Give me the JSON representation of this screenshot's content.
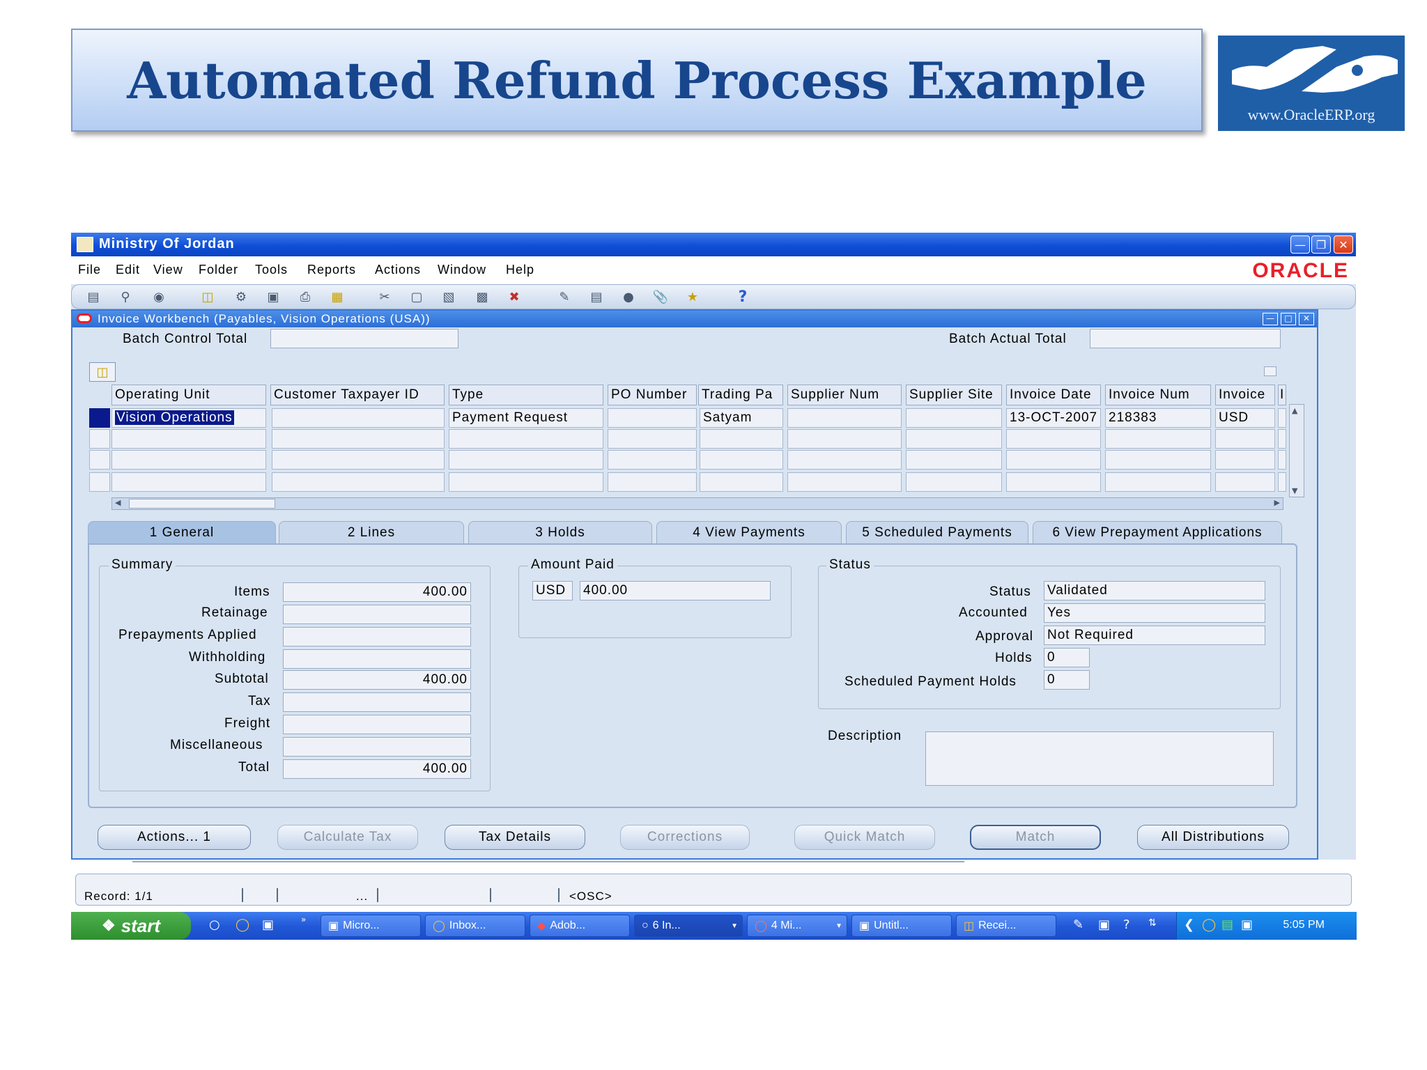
{
  "slide": {
    "title": "Automated Refund Process Example",
    "logo_url": "www.OracleERP.org"
  },
  "window": {
    "title": "Ministry Of Jordan",
    "minimize_icon": "minimize-icon",
    "restore_icon": "restore-icon",
    "close_icon": "close-icon"
  },
  "menu": {
    "items": [
      "File",
      "Edit",
      "View",
      "Folder",
      "Tools",
      "Reports",
      "Actions",
      "Window",
      "Help"
    ],
    "brand": "ORACLE"
  },
  "toolbar": {
    "help_glyph": "?"
  },
  "form": {
    "title": "Invoice Workbench (Payables, Vision Operations (USA))",
    "batch_control_total_label": "Batch Control Total",
    "batch_control_total_value": "",
    "batch_actual_total_label": "Batch Actual Total",
    "batch_actual_total_value": "",
    "columns": [
      "Operating Unit",
      "Customer Taxpayer ID",
      "Type",
      "PO Number",
      "Trading Pa",
      "Supplier Num",
      "Supplier Site",
      "Invoice Date",
      "Invoice Num",
      "Invoice",
      "I"
    ],
    "rows": [
      [
        "Vision Operations",
        "",
        "Payment Request",
        "",
        "Satyam",
        "",
        "",
        "13-OCT-2007",
        "218383",
        "USD"
      ],
      [
        "",
        "",
        "",
        "",
        "",
        "",
        "",
        "",
        "",
        ""
      ],
      [
        "",
        "",
        "",
        "",
        "",
        "",
        "",
        "",
        "",
        ""
      ],
      [
        "",
        "",
        "",
        "",
        "",
        "",
        "",
        "",
        "",
        ""
      ]
    ]
  },
  "tabs": [
    {
      "label": "1 General"
    },
    {
      "label": "2 Lines"
    },
    {
      "label": "3 Holds"
    },
    {
      "label": "4 View Payments"
    },
    {
      "label": "5 Scheduled Payments"
    },
    {
      "label": "6 View Prepayment Applications"
    }
  ],
  "summary": {
    "title": "Summary",
    "items_label": "Items",
    "items_value": "400.00",
    "retainage_label": "Retainage",
    "retainage_value": "",
    "prepayments_label": "Prepayments Applied",
    "prepayments_value": "",
    "withholding_label": "Withholding",
    "withholding_value": "",
    "subtotal_label": "Subtotal",
    "subtotal_value": "400.00",
    "tax_label": "Tax",
    "tax_value": "",
    "freight_label": "Freight",
    "freight_value": "",
    "misc_label": "Miscellaneous",
    "misc_value": "",
    "total_label": "Total",
    "total_value": "400.00"
  },
  "amount_paid": {
    "title": "Amount Paid",
    "currency": "USD",
    "value": "400.00"
  },
  "status": {
    "title": "Status",
    "status_label": "Status",
    "status_value": "Validated",
    "accounted_label": "Accounted",
    "accounted_value": "Yes",
    "approval_label": "Approval",
    "approval_value": "Not Required",
    "holds_label": "Holds",
    "holds_value": "0",
    "sched_holds_label": "Scheduled Payment Holds",
    "sched_holds_value": "0"
  },
  "description": {
    "label": "Description",
    "value": ""
  },
  "buttons": {
    "actions": "Actions... 1",
    "calculate_tax": "Calculate Tax",
    "tax_details": "Tax Details",
    "corrections": "Corrections",
    "quick_match": "Quick Match",
    "match": "Match",
    "all_distributions": "All Distributions"
  },
  "statusbar": {
    "record": "Record: 1/1",
    "ellipsis": "...",
    "osc": "<OSC>"
  },
  "taskbar": {
    "start": "start",
    "tasks": [
      "Micro...",
      "Inbox...",
      "Adob...",
      "6 In...",
      "4 Mi...",
      "Untitl...",
      "Recei..."
    ],
    "clock": "5:05 PM"
  }
}
